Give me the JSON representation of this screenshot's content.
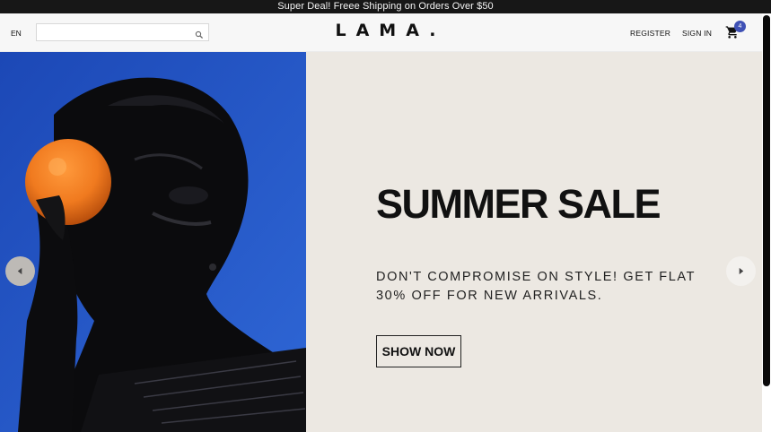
{
  "announcement": "Super Deal! Freee Shipping on Orders Over $50",
  "navbar": {
    "language": "EN",
    "search_placeholder": "",
    "logo": "LAMA.",
    "register": "REGISTER",
    "sign_in": "SIGN IN",
    "cart_count": "4",
    "cart_icon": "shopping-cart-icon",
    "search_icon": "search-icon"
  },
  "slide": {
    "title": "SUMMER SALE",
    "description": "DON'T COMPROMISE ON STYLE! GET FLAT 30% OFF FOR NEW ARRIVALS.",
    "button": "SHOW NOW",
    "background_color": "#ece8e2"
  },
  "colors": {
    "badge": "#3f51b5",
    "announcement_bg": "#171717"
  }
}
